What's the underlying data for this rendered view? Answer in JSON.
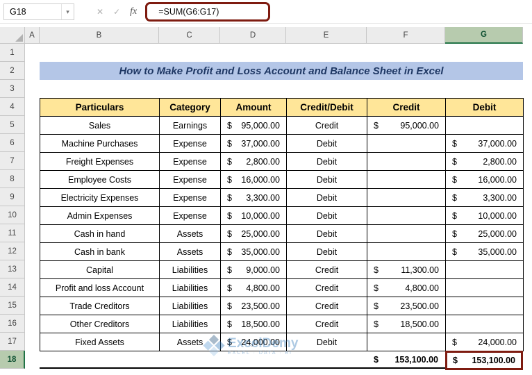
{
  "colors": {
    "accent": "#7E1B10",
    "title_bg": "#B4C6E7",
    "title_text": "#1F3864",
    "table_header_bg": "#FFE699",
    "selected_header_bg": "#B7CBAE"
  },
  "formula_bar": {
    "name_box": "G18",
    "dropdown_icon": "▾",
    "cancel_icon": "✕",
    "enter_icon": "✓",
    "fx_icon": "fx",
    "formula": "=SUM(G6:G17)"
  },
  "columns": [
    "A",
    "B",
    "C",
    "D",
    "E",
    "F",
    "G"
  ],
  "row_numbers": [
    "1",
    "2",
    "3",
    "4",
    "5",
    "6",
    "7",
    "8",
    "9",
    "10",
    "11",
    "12",
    "13",
    "14",
    "15",
    "16",
    "17",
    "18"
  ],
  "title": "How to Make Profit and Loss Account and Balance Sheet in Excel",
  "table": {
    "headers": [
      "Particulars",
      "Category",
      "Amount",
      "Credit/Debit",
      "Credit",
      "Debit"
    ],
    "rows": [
      {
        "p": "Sales",
        "cat": "Earnings",
        "asym": "$",
        "amt": "95,000.00",
        "cd": "Credit",
        "csym": "$",
        "cr": "95,000.00",
        "dsym": "",
        "db": ""
      },
      {
        "p": "Machine Purchases",
        "cat": "Expense",
        "asym": "$",
        "amt": "37,000.00",
        "cd": "Debit",
        "csym": "",
        "cr": "",
        "dsym": "$",
        "db": "37,000.00"
      },
      {
        "p": "Freight Expenses",
        "cat": "Expense",
        "asym": "$",
        "amt": "2,800.00",
        "cd": "Debit",
        "csym": "",
        "cr": "",
        "dsym": "$",
        "db": "2,800.00"
      },
      {
        "p": "Employee Costs",
        "cat": "Expense",
        "asym": "$",
        "amt": "16,000.00",
        "cd": "Debit",
        "csym": "",
        "cr": "",
        "dsym": "$",
        "db": "16,000.00"
      },
      {
        "p": "Electricity Expenses",
        "cat": "Expense",
        "asym": "$",
        "amt": "3,300.00",
        "cd": "Debit",
        "csym": "",
        "cr": "",
        "dsym": "$",
        "db": "3,300.00"
      },
      {
        "p": "Admin Expenses",
        "cat": "Expense",
        "asym": "$",
        "amt": "10,000.00",
        "cd": "Debit",
        "csym": "",
        "cr": "",
        "dsym": "$",
        "db": "10,000.00"
      },
      {
        "p": "Cash in hand",
        "cat": "Assets",
        "asym": "$",
        "amt": "25,000.00",
        "cd": "Debit",
        "csym": "",
        "cr": "",
        "dsym": "$",
        "db": "25,000.00"
      },
      {
        "p": "Cash in bank",
        "cat": "Assets",
        "asym": "$",
        "amt": "35,000.00",
        "cd": "Debit",
        "csym": "",
        "cr": "",
        "dsym": "$",
        "db": "35,000.00"
      },
      {
        "p": "Capital",
        "cat": "Liabilities",
        "asym": "$",
        "amt": "9,000.00",
        "cd": "Credit",
        "csym": "$",
        "cr": "11,300.00",
        "dsym": "",
        "db": ""
      },
      {
        "p": "Profit and loss Account",
        "cat": "Liabilities",
        "asym": "$",
        "amt": "4,800.00",
        "cd": "Credit",
        "csym": "$",
        "cr": "4,800.00",
        "dsym": "",
        "db": ""
      },
      {
        "p": "Trade Creditors",
        "cat": "Liabilities",
        "asym": "$",
        "amt": "23,500.00",
        "cd": "Credit",
        "csym": "$",
        "cr": "23,500.00",
        "dsym": "",
        "db": ""
      },
      {
        "p": "Other Creditors",
        "cat": "Liabilities",
        "asym": "$",
        "amt": "18,500.00",
        "cd": "Credit",
        "csym": "$",
        "cr": "18,500.00",
        "dsym": "",
        "db": ""
      },
      {
        "p": "Fixed Assets",
        "cat": "Assets",
        "asym": "$",
        "amt": "24,000.00",
        "cd": "Debit",
        "csym": "",
        "cr": "",
        "dsym": "$",
        "db": "24,000.00"
      }
    ]
  },
  "totals": {
    "csym": "$",
    "cr": "153,100.00",
    "dsym": "$",
    "db": "153,100.00"
  },
  "watermark": {
    "brand": "ExcelDemy",
    "tagline": "EXCEL · DATA · BI"
  }
}
